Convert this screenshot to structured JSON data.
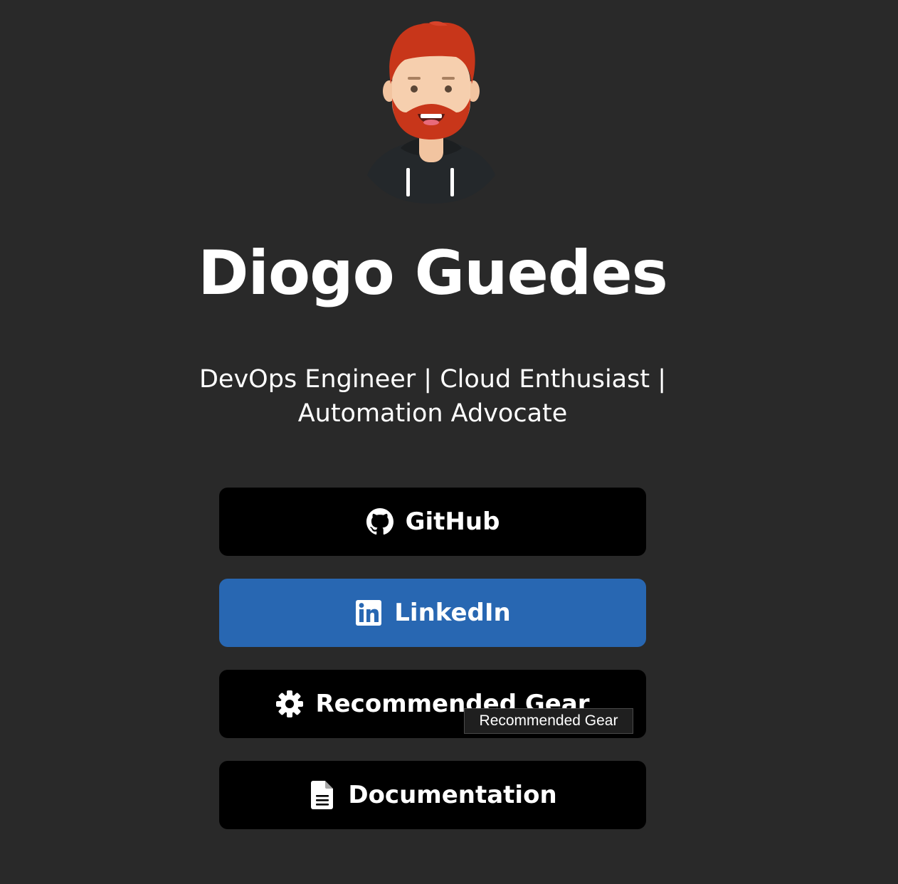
{
  "profile": {
    "name": "Diogo Guedes",
    "tagline": "DevOps Engineer | Cloud Enthusiast | Automation Advocate",
    "avatar_icon": "avatar-illustration"
  },
  "links": [
    {
      "label": "GitHub",
      "icon": "github-icon",
      "color": "#000000"
    },
    {
      "label": "LinkedIn",
      "icon": "linkedin-icon",
      "color": "#2867b2"
    },
    {
      "label": "Recommended Gear",
      "icon": "gear-icon",
      "color": "#000000"
    },
    {
      "label": "Documentation",
      "icon": "document-icon",
      "color": "#000000"
    }
  ],
  "tooltip": {
    "text": "Recommended Gear"
  },
  "colors": {
    "background": "#292929",
    "button": "#000000",
    "linkedin": "#2867b2",
    "hair": "#c8361a",
    "skin": "#f6cfae"
  }
}
